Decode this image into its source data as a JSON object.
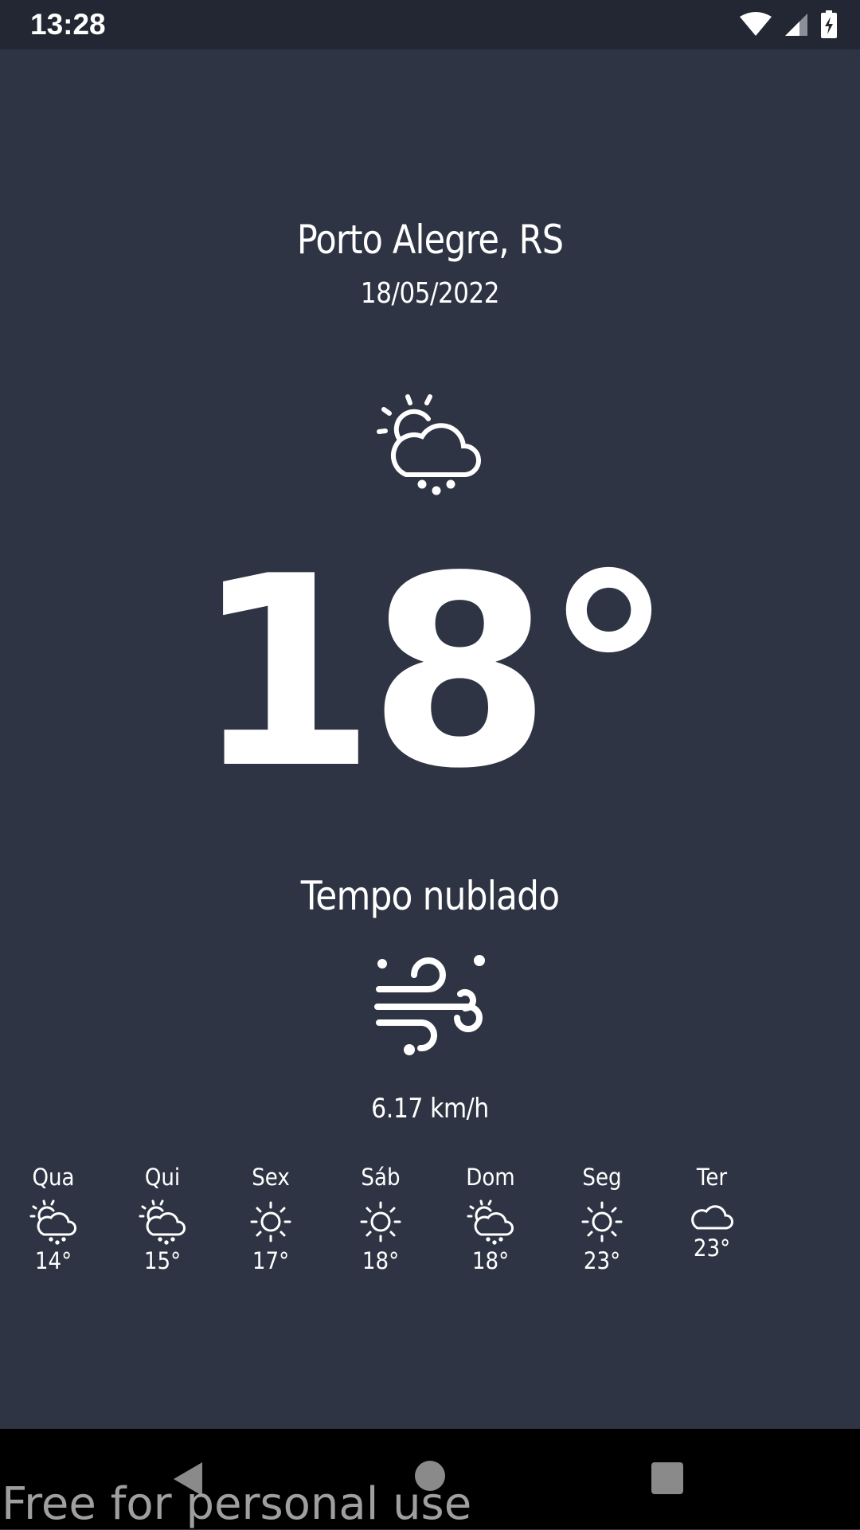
{
  "status_bar": {
    "time": "13:28",
    "icons": [
      "wifi-icon",
      "signal-icon",
      "battery-charging-icon"
    ]
  },
  "location": {
    "city": "Porto Alegre, RS",
    "date": "18/05/2022"
  },
  "current": {
    "icon": "partly-cloudy-rain-icon",
    "temperature": "18°",
    "condition": "Tempo nublado",
    "wind_icon": "wind-icon",
    "wind_speed": "6.17 km/h"
  },
  "forecast": [
    {
      "day": "Qua",
      "icon": "partly-cloudy-rain-icon",
      "temp": "14°"
    },
    {
      "day": "Qui",
      "icon": "partly-cloudy-rain-icon",
      "temp": "15°"
    },
    {
      "day": "Sex",
      "icon": "sun-icon",
      "temp": "17°"
    },
    {
      "day": "Sáb",
      "icon": "sun-icon",
      "temp": "18°"
    },
    {
      "day": "Dom",
      "icon": "partly-cloudy-rain-icon",
      "temp": "18°"
    },
    {
      "day": "Seg",
      "icon": "sun-icon",
      "temp": "23°"
    },
    {
      "day": "Ter",
      "icon": "cloud-icon",
      "temp": "23°"
    }
  ],
  "nav_bar": {
    "icons": [
      "back-icon",
      "home-icon",
      "recents-icon"
    ]
  },
  "watermark": "Free for personal use",
  "colors": {
    "background": "#2e3443",
    "status_bar": "#222733",
    "nav_bar": "#000000",
    "text": "#ffffff"
  }
}
